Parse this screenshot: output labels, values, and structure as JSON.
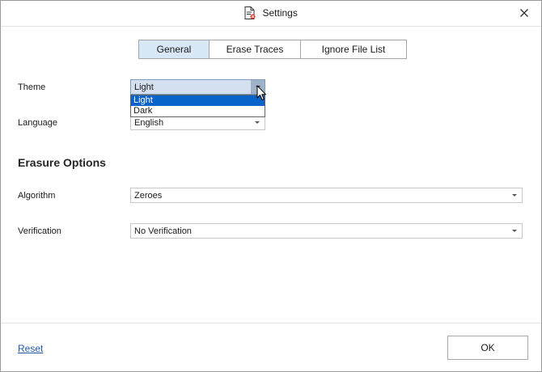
{
  "window": {
    "title": "Settings",
    "close_icon": "close-icon",
    "title_icon": "document-settings-icon"
  },
  "tabs": [
    {
      "label": "General",
      "active": true
    },
    {
      "label": "Erase Traces",
      "active": false
    },
    {
      "label": "Ignore File List",
      "active": false
    }
  ],
  "general": {
    "theme": {
      "label": "Theme",
      "value": "Light",
      "options": [
        "Light",
        "Dark"
      ],
      "selected_option": "Light"
    },
    "language": {
      "label": "Language",
      "value": "English"
    }
  },
  "erasure": {
    "section_title": "Erasure Options",
    "algorithm": {
      "label": "Algorithm",
      "value": "Zeroes"
    },
    "verification": {
      "label": "Verification",
      "value": "No Verification"
    }
  },
  "footer": {
    "reset_label": "Reset",
    "ok_label": "OK"
  },
  "colors": {
    "active_tab": "#d9e8f7",
    "selection": "#0a63c9",
    "link": "#1f5aa8"
  }
}
